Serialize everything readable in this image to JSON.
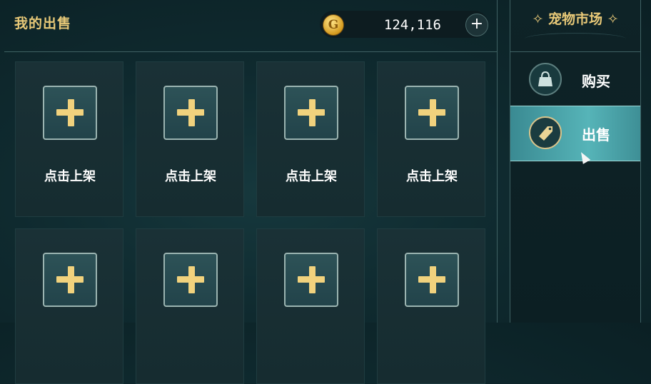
{
  "sale_panel": {
    "title": "我的出售",
    "coins": "124,116",
    "coin_symbol": "G",
    "add_symbol": "+"
  },
  "slots": [
    {
      "label": "点击上架"
    },
    {
      "label": "点击上架"
    },
    {
      "label": "点击上架"
    },
    {
      "label": "点击上架"
    },
    {
      "label": ""
    },
    {
      "label": ""
    },
    {
      "label": ""
    },
    {
      "label": ""
    }
  ],
  "market": {
    "title": "✧ 宠物市场 ✧",
    "tabs": [
      {
        "label": "购买",
        "icon": "bag-icon",
        "active": false
      },
      {
        "label": "出售",
        "icon": "tag-icon",
        "active": true
      }
    ]
  },
  "colors": {
    "gold": "#e8c978",
    "active_tab": "#56b4b8",
    "panel": "#162c30"
  }
}
